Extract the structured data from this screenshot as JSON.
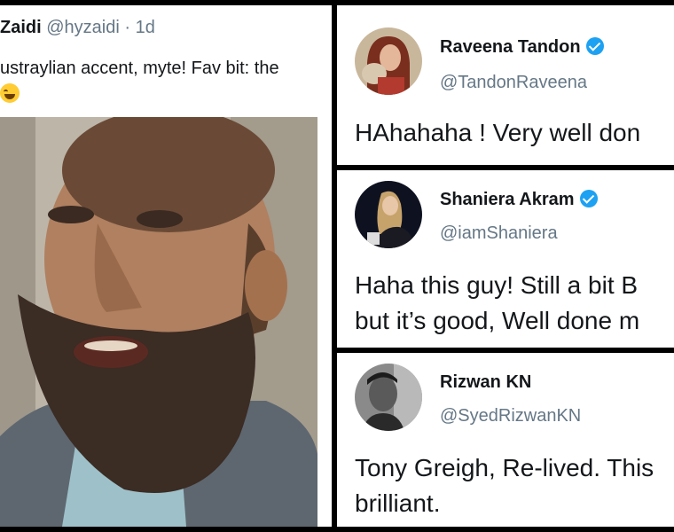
{
  "left_tweet": {
    "name": "Zaidi",
    "handle": "@hyzaidi",
    "separator": "·",
    "time": "1d",
    "text_line1": "ustraylian accent, myte! Fav bit: the",
    "emoji": "face-with-tears-of-joy-icon",
    "video_alt": "bearded-man-video-frame"
  },
  "tweets": [
    {
      "name": "Raveena Tandon",
      "handle": "@TandonRaveena",
      "verified": true,
      "lines": [
        "HAhahaha ! Very well don"
      ]
    },
    {
      "name": "Shaniera Akram",
      "handle": "@iamShaniera",
      "verified": true,
      "lines": [
        "Haha this guy! Still a bit B",
        "but it’s good, Well done m"
      ]
    },
    {
      "name": "Rizwan KN",
      "handle": "@SyedRizwanKN",
      "verified": false,
      "lines": [
        "Tony Greigh, Re-lived. This",
        "brilliant."
      ]
    }
  ],
  "colors": {
    "text": "#14171a",
    "muted": "#657786",
    "verified": "#1da1f2",
    "background": "#000000"
  }
}
